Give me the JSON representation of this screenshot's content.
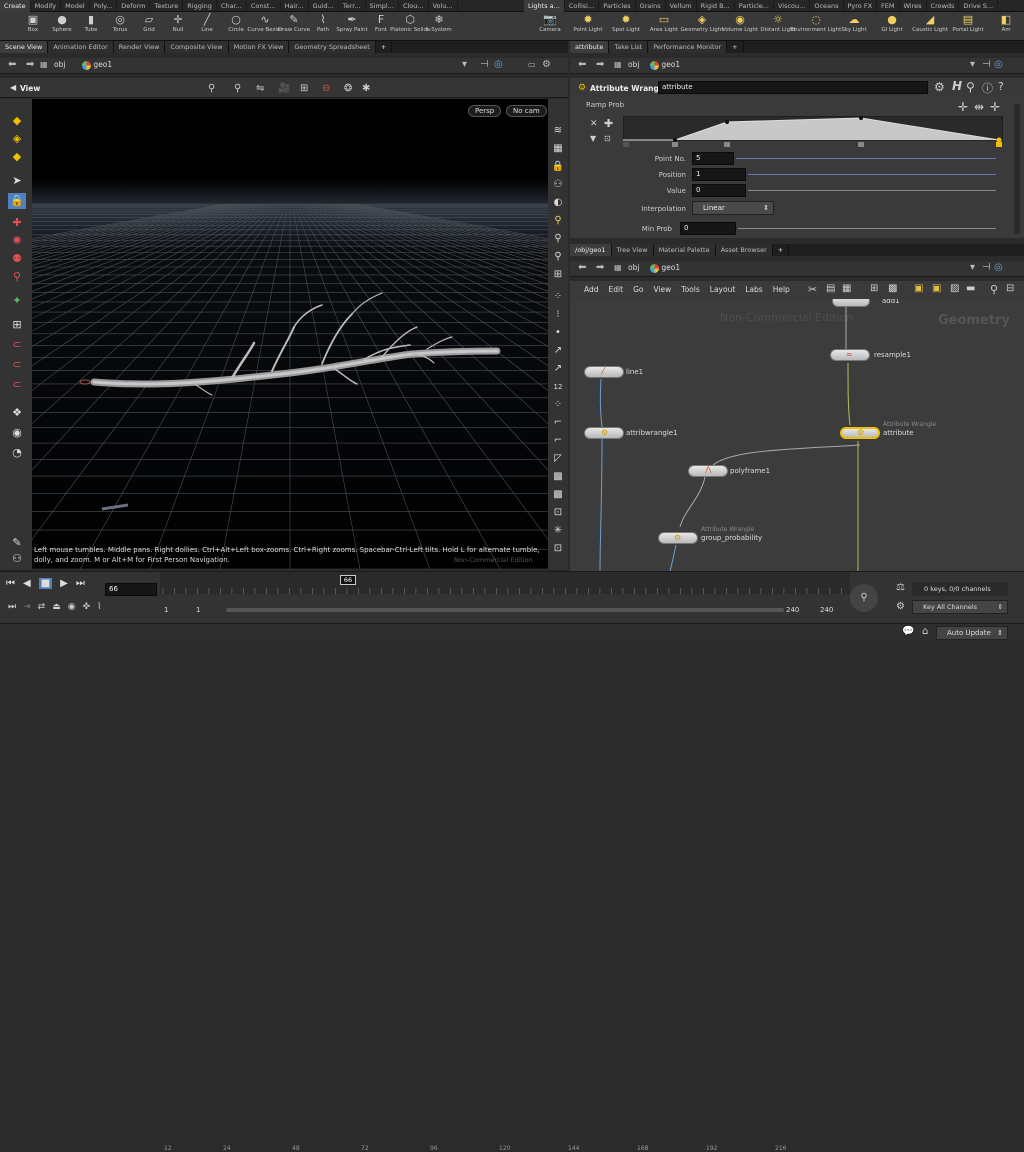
{
  "shelf_tabs_left": [
    "Create",
    "Modify",
    "Model",
    "Poly...",
    "Deform",
    "Texture",
    "Rigging",
    "Char...",
    "Const...",
    "Hair...",
    "Guid...",
    "Terr...",
    "Simpl...",
    "Clou...",
    "Volu..."
  ],
  "shelf_tabs_right": [
    "Lights a...",
    "Collisi...",
    "Particles",
    "Grains",
    "Vellum",
    "Rigid B...",
    "Particle...",
    "Viscou...",
    "Oceans",
    "Pyro FX",
    "FEM",
    "Wires",
    "Crowds",
    "Drive S..."
  ],
  "tools_left": [
    "Box",
    "Sphere",
    "Tube",
    "Torus",
    "Grid",
    "Null",
    "Line",
    "Circle",
    "Curve Bezier",
    "Draw Curve",
    "Path",
    "Spray Paint",
    "Font",
    "Platonic Solids",
    "L-System"
  ],
  "tools_right": [
    "Camera",
    "Point Light",
    "Spot Light",
    "Area Light",
    "Geometry Light",
    "Volume Light",
    "Distant Light",
    "Environment Light",
    "Sky Light",
    "GI Light",
    "Caustic Light",
    "Portal Light",
    "Am"
  ],
  "left_panel": {
    "tabs": [
      "Scene View",
      "Animation Editor",
      "Render View",
      "Composite View",
      "Motion FX View",
      "Geometry Spreadsheet"
    ],
    "path_root": "obj",
    "path_node": "geo1",
    "view_label": "View",
    "persp": "Persp",
    "cam": "No cam",
    "help_line1": "Left mouse tumbles. Middle pans. Right dollies. Ctrl+Alt+Left box-zooms. Ctrl+Right zooms. Spacebar-Ctrl-Left tilts. Hold L for alternate tumble,",
    "help_line2": "dolly, and zoom.     M or Alt+M for First Person Navigation.",
    "watermark": "Non-Commercial Edition"
  },
  "params_panel": {
    "tabs": [
      "attribute",
      "Take List",
      "Performance Monitor"
    ],
    "path_root": "obj",
    "path_node": "geo1",
    "node_type": "Attribute Wrangle",
    "node_name": "attribute",
    "ramp_label": "Ramp Prob",
    "fields": [
      {
        "label": "Point No.",
        "value": "5"
      },
      {
        "label": "Position",
        "value": "1"
      },
      {
        "label": "Value",
        "value": "0"
      }
    ],
    "interp_label": "Interpolation",
    "interp_value": "Linear",
    "minprob_label": "Min Prob",
    "minprob_value": "0"
  },
  "network_panel": {
    "tabs": [
      "/obj/geo1",
      "Tree View",
      "Material Palette",
      "Asset Browser"
    ],
    "path_root": "obj",
    "path_node": "geo1",
    "menu": [
      "Add",
      "Edit",
      "Go",
      "View",
      "Tools",
      "Layout",
      "Labs",
      "Help"
    ],
    "watermark": "Non-Commercial Edition",
    "context": "Geometry",
    "nodes": [
      {
        "name": "add1",
        "sub": ""
      },
      {
        "name": "resample1",
        "sub": ""
      },
      {
        "name": "line1",
        "sub": ""
      },
      {
        "name": "attribwrangle1",
        "sub": ""
      },
      {
        "name": "attribute",
        "sub": "Attribute Wrangle"
      },
      {
        "name": "polyframe1",
        "sub": ""
      },
      {
        "name": "group_probability",
        "sub": "Attribute Wrangle"
      }
    ]
  },
  "timeline": {
    "current_frame": "66",
    "marker": "66",
    "ticks": [
      "1",
      "24",
      "48",
      "72",
      "96",
      "120",
      "144",
      "168",
      "192",
      "216",
      "2"
    ],
    "start": "1",
    "start2": "1",
    "end": "240",
    "end2": "240"
  },
  "keys": {
    "status": "0 keys, 0/0 channels",
    "channels": "Key All Channels"
  },
  "status": {
    "auto_update": "Auto Update"
  },
  "colors": {
    "accent": "#f0c000",
    "viewport_bg": "#000000",
    "panel_bg": "#3a3a3a"
  }
}
